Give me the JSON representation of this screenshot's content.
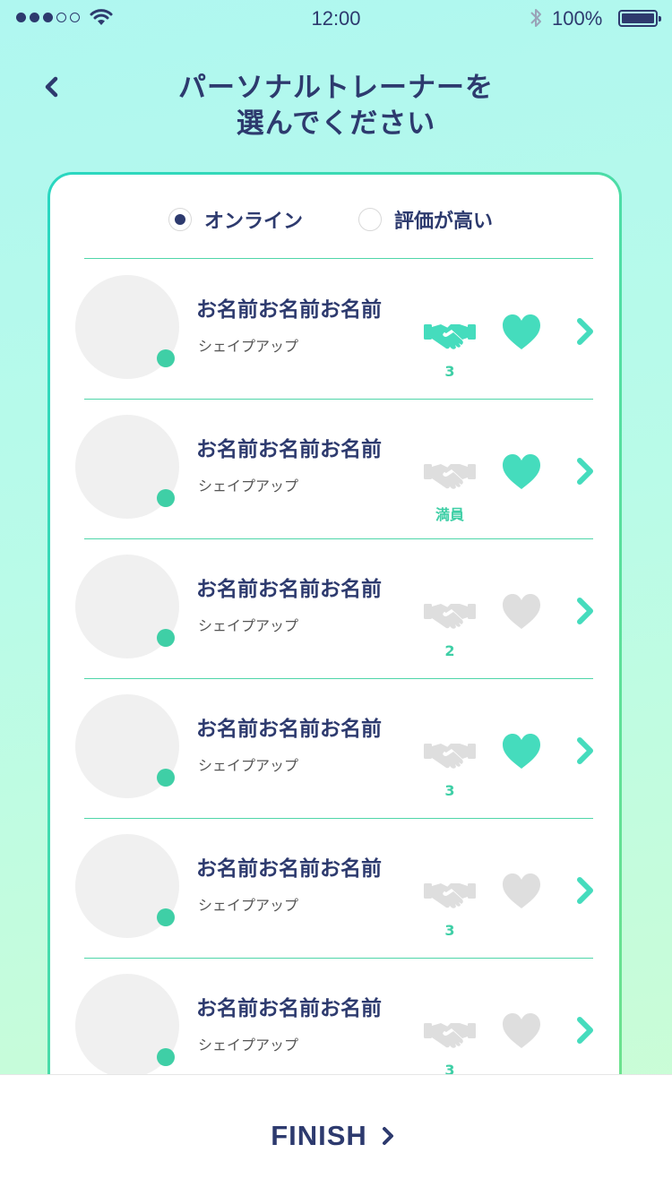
{
  "status_bar": {
    "time": "12:00",
    "battery": "100%"
  },
  "header": {
    "title_line1": "パーソナルトレーナーを",
    "title_line2": "選んでください"
  },
  "filters": [
    {
      "label": "オンライン",
      "selected": true
    },
    {
      "label": "評価が高い",
      "selected": false
    }
  ],
  "trainers": [
    {
      "name": "お名前お名前お名前",
      "category": "シェイプアップ",
      "handshake_count": "3",
      "handshake_active": true,
      "favorite": true
    },
    {
      "name": "お名前お名前お名前",
      "category": "シェイプアップ",
      "handshake_count": "満員",
      "handshake_active": false,
      "favorite": true
    },
    {
      "name": "お名前お名前お名前",
      "category": "シェイプアップ",
      "handshake_count": "2",
      "handshake_active": false,
      "favorite": false
    },
    {
      "name": "お名前お名前お名前",
      "category": "シェイプアップ",
      "handshake_count": "3",
      "handshake_active": false,
      "favorite": true
    },
    {
      "name": "お名前お名前お名前",
      "category": "シェイプアップ",
      "handshake_count": "3",
      "handshake_active": false,
      "favorite": false
    },
    {
      "name": "お名前お名前お名前",
      "category": "シェイプアップ",
      "handshake_count": "3",
      "handshake_active": false,
      "favorite": false
    }
  ],
  "footer": {
    "finish_label": "FINISH"
  },
  "colors": {
    "accent": "#45dcbd",
    "navy": "#2d3a6e",
    "inactive": "#dedede"
  }
}
